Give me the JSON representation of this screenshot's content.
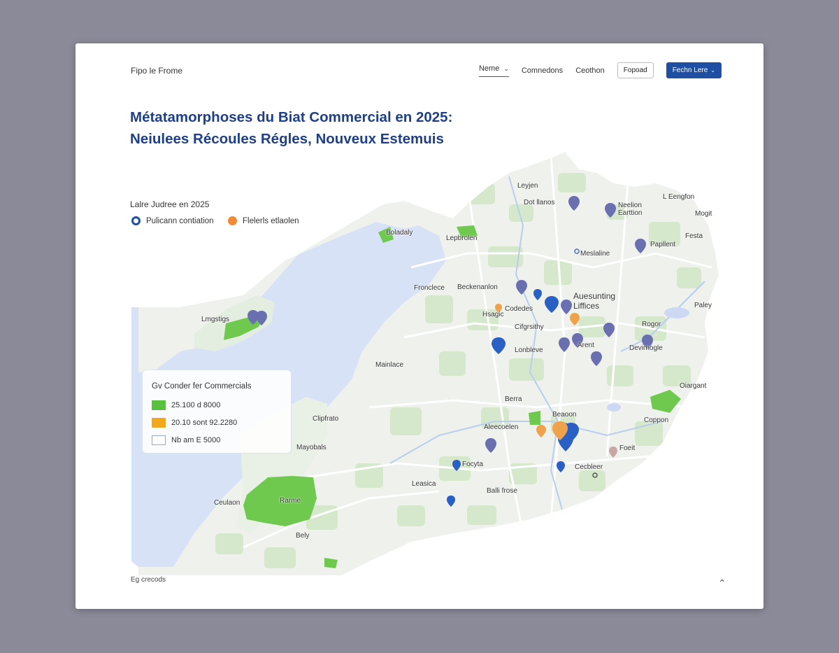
{
  "header": {
    "brand": "Fipo le Frome",
    "nav": [
      {
        "label": "Neme",
        "active": true
      },
      {
        "label": "Comnedons"
      },
      {
        "label": "Ceothon"
      }
    ],
    "outline_button": "Fopoad",
    "primary_button": "Fechn Lere"
  },
  "title": {
    "line1": "Métatamorphoses du Biat Commercial en 2025:",
    "line2": "Neiulees Récoules Régles, Nouveux Estemuis"
  },
  "layers": {
    "title": "Lalre Judree en 2025",
    "items": [
      {
        "label": "Pulicann contiation",
        "color": "#1e4fa3"
      },
      {
        "label": "Flelerls etlaolen",
        "color": "#f08a35"
      }
    ]
  },
  "legend": {
    "title": "Gv Conder fer Commercials",
    "items": [
      {
        "label": "25.100 d 8000",
        "color": "#5ac13f"
      },
      {
        "label": "20.10 sont 92.2280",
        "color": "#f3a81b"
      },
      {
        "label": "Nb am E 5000",
        "color": "#ffffff"
      }
    ]
  },
  "map_labels": [
    "Leyjen",
    "Dot llanos",
    "Neelion Earttion",
    "L Eengfon",
    "Mogit",
    "Festa",
    "Boladaly",
    "Lepbrolen",
    "Meslaline",
    "Papllent",
    "Fronclece",
    "Beckenanlon",
    "Auesunting Liffices",
    "Paley",
    "Lmgstigs",
    "Codedes",
    "Hsagic",
    "Cifgrsithy",
    "Rogor",
    "Lonbleve",
    "Arent",
    "Devirnogle",
    "Mainlace",
    "Oiargant",
    "Berra",
    "Beaoon",
    "Clipfrato",
    "Aleecoelen",
    "Coppon",
    "Mayobals",
    "Foeit",
    "Focyta",
    "Cecbleer",
    "Leasica",
    "Balli frose",
    "Ceulaon",
    "Rarme",
    "Bely"
  ],
  "footer": {
    "note": "Eg crecods",
    "icon": "arrow-up-icon"
  }
}
